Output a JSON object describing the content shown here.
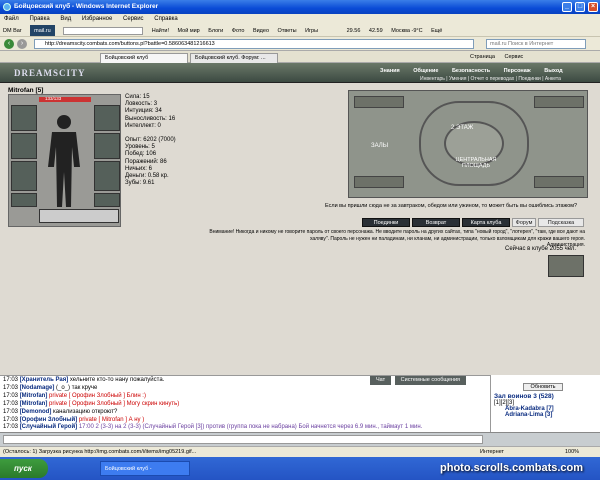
{
  "window": {
    "title": "Бойцовский клуб - Windows Internet Explorer"
  },
  "menu": [
    "Файл",
    "Правка",
    "Вид",
    "Избранное",
    "Сервис",
    "Справка"
  ],
  "toolbar": {
    "items": [
      "DM Bar",
      "mail.ru",
      "Найти!",
      "Мой мир",
      "Блоги",
      "Фото",
      "Видео",
      "Ответы",
      "Игры",
      "29.56",
      "42.59",
      "Москва -9°C",
      "Ещё"
    ]
  },
  "address": {
    "url": "http://dreamscity.combats.com/buttons.pl?battle=0.586063481216613",
    "search_placeholder": "mail.ru Поиск в Интернет"
  },
  "tabs": [
    "Бойцовский клуб",
    "Бойцовский клуб. Форум: ..."
  ],
  "page_tools": [
    "Страница",
    "Сервис"
  ],
  "site": {
    "logo": "DREAMSCITY",
    "nav": [
      "Знания",
      "Общение",
      "Безопасность",
      "Персонаж",
      "Выход"
    ],
    "subnav": "Инвентарь | Умения | Отчет о переводах | Поединки | Анкета"
  },
  "character": {
    "name": "Mitrofan",
    "level": "[5]",
    "hp_label": "133/133"
  },
  "stats": [
    "Сила: 15",
    "Ловкость: 3",
    "Интуиция: 34",
    "Выносливость: 16",
    "Интеллект: 0"
  ],
  "stats2": [
    "Опыт: 6202 (7000)",
    "Уровень: 5",
    "Побед: 106",
    "Поражений: 86",
    "Ничьих: 6",
    "Деньги: 0.58 кр.",
    "Зубы: 9.61"
  ],
  "map": {
    "labels": [
      "2 ЭТАЖ",
      "ЗАЛЫ",
      "ЦЕНТРАЛЬНАЯ ПЛОЩАДЬ"
    ],
    "caption": "Если вы пришли сюда не за завтраком, обедом или ужином, то может быть вы ошиблись этажом?"
  },
  "game_buttons": [
    "Поединки",
    "Возврат",
    "Карта клуба",
    "Форум",
    "Подсказка"
  ],
  "warning": {
    "text": "Внимание! Никогда и никому не говорите пароль от своего персонажа. Не вводите пароль на других сайтах, типа \"новый город\", \"лотерея\", \"там, где все дают на халяву\". Пароль не нужен ни паладинам, ни кланам, ни администрации, только взломщикам для кражи вашего героя.",
    "signature": "Администрация."
  },
  "online": "Сейчас в клубе 2055 чел.",
  "chat": {
    "tabs": [
      "Чат",
      "Системные сообщения"
    ],
    "lines": [
      {
        "time": "17:03",
        "nick": "[Хранитель Рая]",
        "text": " хельните кто-то нану пожалуйста."
      },
      {
        "time": "17:03",
        "nick": "[Nodamage]",
        "text": " (_o_) так круче"
      },
      {
        "time": "17:03",
        "nick": "[Mitrofan]",
        "text": " private [ Орофин Злобный ] Блин :)"
      },
      {
        "time": "17:03",
        "nick": "[Mitrofan]",
        "text": " private [ Орофин Злобный ] Могу скрин кинуть)"
      },
      {
        "time": "17:03",
        "nick": "[Demonod]",
        "text": " канализацию откроют?"
      },
      {
        "time": "17:03",
        "nick": "[Орофин Злобный]",
        "text": " private [ Mitrofan ] А ну )"
      },
      {
        "time": "17:03",
        "nick": "[Случайный Герой]",
        "text": " 17:00 2 (3-3) на 2 (3-3) (Случайный Герой [3]) против (группа пока не набрана) Бой начнется через 6.9 мин., таймаут 1 мин."
      }
    ]
  },
  "room": {
    "refresh": "Обновить",
    "title": "Зал воинов 3 (528)",
    "pages": "[1][2][3]",
    "users": [
      "Abra-Kadabra [7]",
      "Adriana-Lima [3]"
    ]
  },
  "status": {
    "text": "(Осталось: 1) Загрузка рисунка http://img.combats.com/i/items/img05219.gif...",
    "zone": "Интернет",
    "zoom": "100%"
  },
  "taskbar": {
    "start": "пуск",
    "item": "Бойцовский клуб -",
    "watermark": "photo.scrolls.combats.com"
  }
}
